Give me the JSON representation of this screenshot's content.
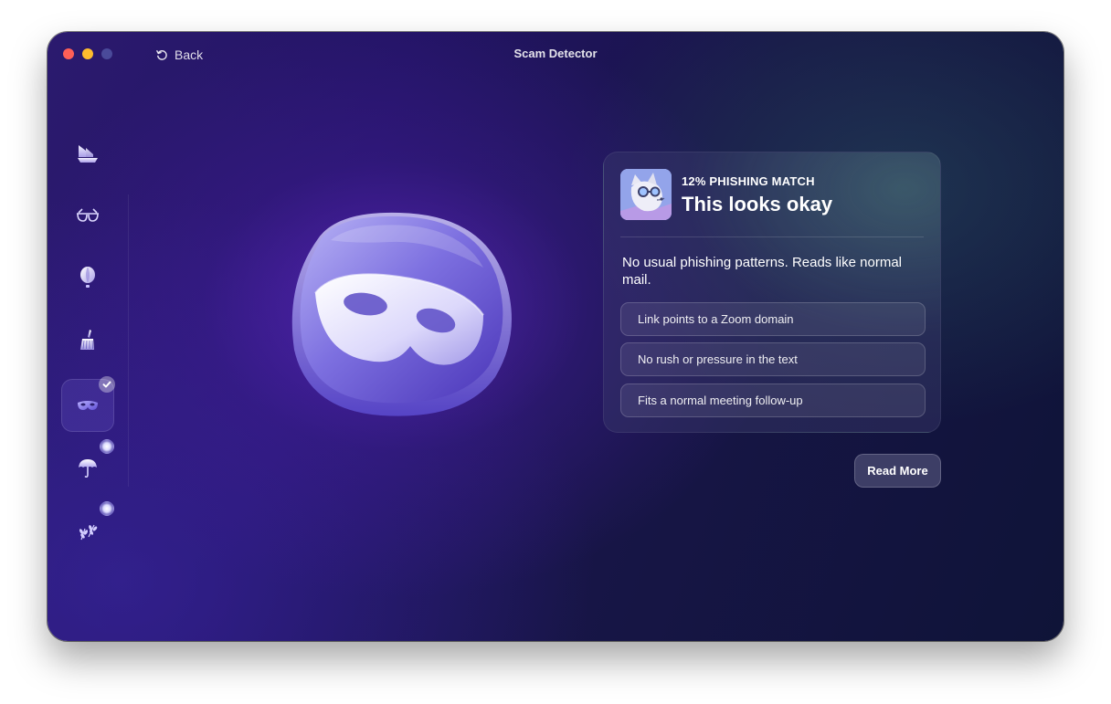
{
  "window": {
    "title": "Scam Detector",
    "back_label": "Back"
  },
  "sidebar": {
    "items": [
      {
        "name": "ship-icon",
        "status": "none"
      },
      {
        "name": "glasses-icon",
        "status": "none"
      },
      {
        "name": "balloon-icon",
        "status": "none"
      },
      {
        "name": "broom-icon",
        "status": "none"
      },
      {
        "name": "mask-icon",
        "status": "completed",
        "active": true
      },
      {
        "name": "umbrella-icon",
        "status": "pending"
      },
      {
        "name": "branches-icon",
        "status": "pending"
      }
    ]
  },
  "result": {
    "match_label": "12% PHISHING MATCH",
    "title": "This looks okay",
    "description": "No usual phishing patterns. Reads like normal mail.",
    "reasons": [
      "Link points to a Zoom domain",
      "No rush or pressure in the text",
      "Fits a normal meeting follow-up"
    ],
    "read_more_label": "Read More"
  },
  "colors": {
    "close": "#fe5f57",
    "minimize": "#febc2e",
    "background_start": "#2b1a6e",
    "background_end": "#0f1438"
  }
}
